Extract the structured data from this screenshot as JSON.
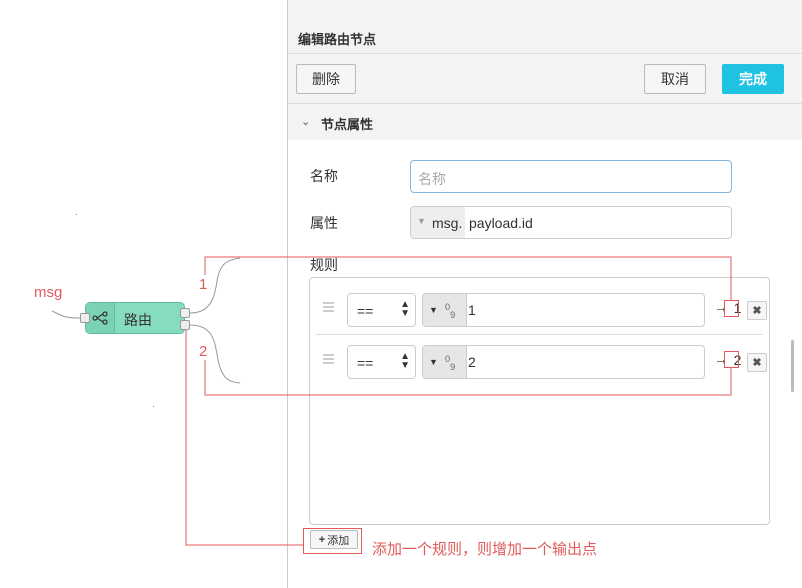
{
  "canvas": {
    "msg_label": "msg",
    "node_label": "路由",
    "output_1": "1",
    "output_2": "2",
    "annotation": "添加一个规则，则增加一个输出点"
  },
  "panel": {
    "title": "编辑路由节点",
    "delete_label": "删除",
    "cancel_label": "取消",
    "done_label": "完成",
    "section_label": "节点属性",
    "name_label": "名称",
    "name_placeholder": "名称",
    "property_label": "属性",
    "property_prefix": "msg.",
    "property_value": "payload.id",
    "rules_label": "规则",
    "rules": [
      {
        "operator": "==",
        "value": "1",
        "output": "1"
      },
      {
        "operator": "==",
        "value": "2",
        "output": "2"
      }
    ],
    "add_label": "添加"
  },
  "colors": {
    "accent": "#1fc2e0",
    "node": "#86dcc0",
    "annotation": "#e05a5a"
  },
  "icons": [
    "switch-icon",
    "chevron-down-icon",
    "drag-handle-icon",
    "number-type-icon",
    "close-icon",
    "plus-icon"
  ]
}
